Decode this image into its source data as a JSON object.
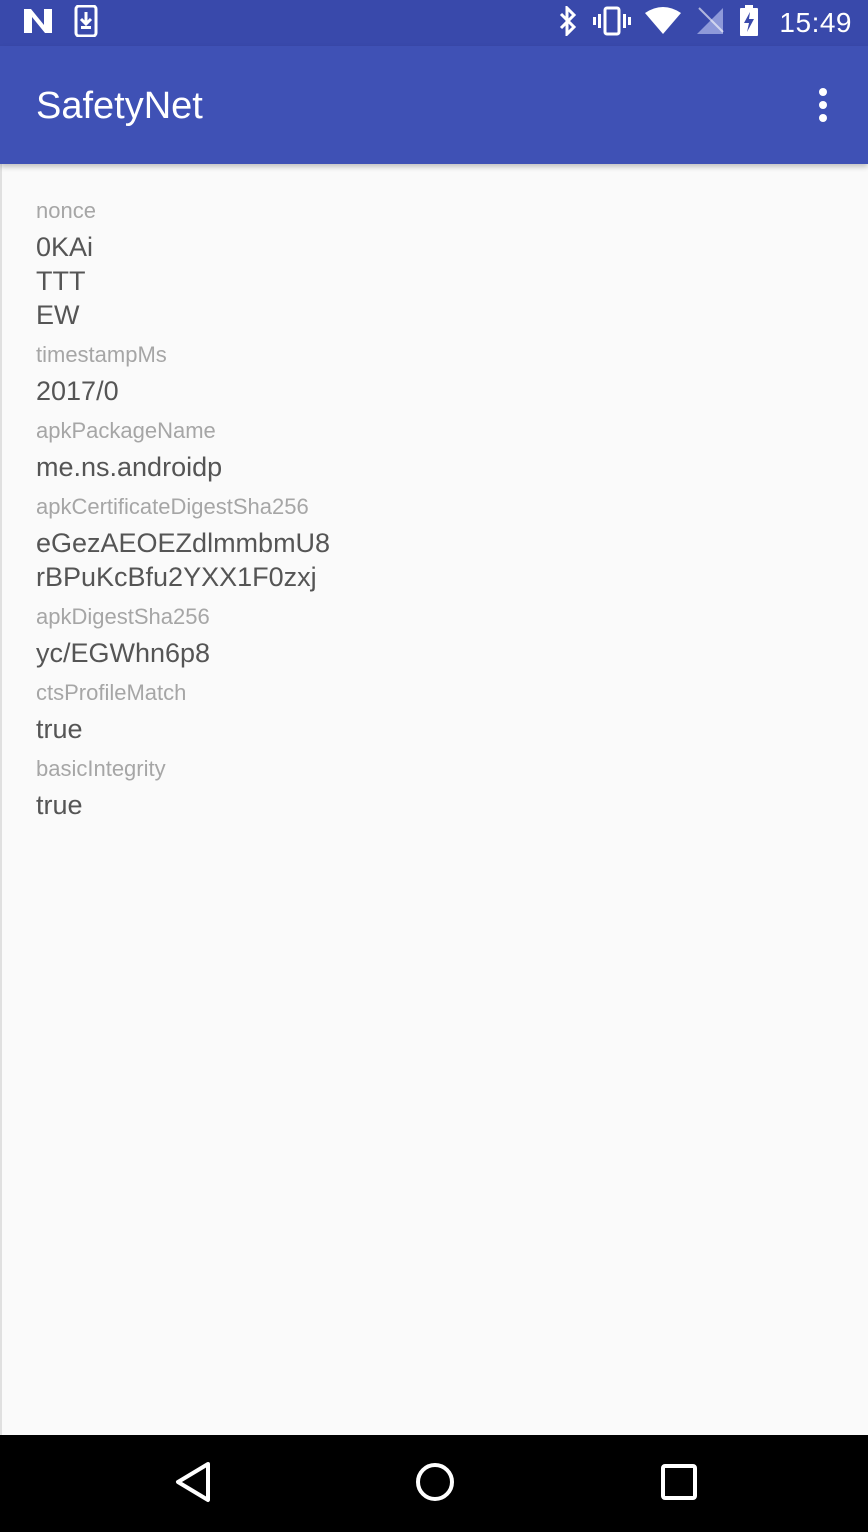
{
  "status_bar": {
    "time": "15:49",
    "icons": [
      "notification-n-icon",
      "download-icon",
      "bluetooth-icon",
      "vibrate-icon",
      "wifi-icon",
      "no-sim-icon",
      "battery-charging-icon"
    ]
  },
  "app_bar": {
    "title": "SafetyNet",
    "menu_icon": "more-vert-icon"
  },
  "fields": [
    {
      "label": "nonce",
      "value": "0KAi\nTTT\nEW"
    },
    {
      "label": "timestampMs",
      "value": "2017/0"
    },
    {
      "label": "apkPackageName",
      "value": "me.ns.androidp"
    },
    {
      "label": "apkCertificateDigestSha256",
      "value": "eGezAEOEZdlmmbmU8\nrBPuKcBfu2YXX1F0zxj"
    },
    {
      "label": "apkDigestSha256",
      "value": "yc/EGWhn6p8"
    },
    {
      "label": "ctsProfileMatch",
      "value": "true"
    },
    {
      "label": "basicIntegrity",
      "value": "true"
    }
  ],
  "nav_bar": {
    "icons": [
      "back-icon",
      "home-icon",
      "recents-icon"
    ]
  },
  "colors": {
    "status_bar": "#3949ab",
    "app_bar": "#3f51b5",
    "background": "#fafafa",
    "label": "#a6a6a6",
    "value": "#555555"
  }
}
